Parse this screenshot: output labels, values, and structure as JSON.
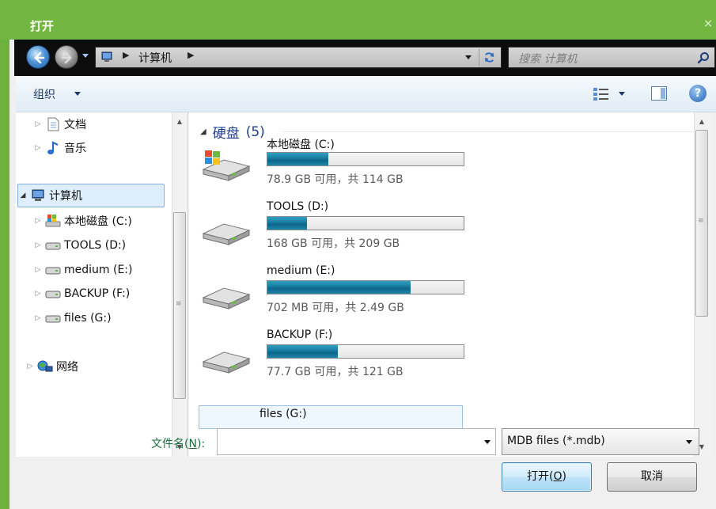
{
  "window": {
    "title": "打开",
    "close_glyph": "×"
  },
  "address": {
    "location": "计算机",
    "search_placeholder": "搜索 计算机"
  },
  "toolbar": {
    "organize": "组织"
  },
  "nav": {
    "items": [
      {
        "label": "文档",
        "icon": "document-icon"
      },
      {
        "label": "音乐",
        "icon": "music-icon"
      },
      {
        "label": "计算机",
        "icon": "computer-icon",
        "selected": true
      },
      {
        "label": "本地磁盘 (C:)",
        "icon": "windows-drive-icon"
      },
      {
        "label": "TOOLS (D:)",
        "icon": "drive-icon"
      },
      {
        "label": "medium (E:)",
        "icon": "drive-icon"
      },
      {
        "label": "BACKUP (F:)",
        "icon": "drive-icon"
      },
      {
        "label": "files (G:)",
        "icon": "drive-icon"
      },
      {
        "label": "网络",
        "icon": "network-icon"
      }
    ]
  },
  "content": {
    "group": {
      "title": "硬盘",
      "count": "(5)"
    },
    "drives": [
      {
        "name": "本地磁盘 (C:)",
        "space": "78.9 GB 可用，共 114 GB",
        "used_fraction": 0.31,
        "system": true
      },
      {
        "name": "TOOLS (D:)",
        "space": "168 GB 可用，共 209 GB",
        "used_fraction": 0.2,
        "system": false
      },
      {
        "name": "medium (E:)",
        "space": "702 MB 可用，共 2.49 GB",
        "used_fraction": 0.73,
        "system": false
      },
      {
        "name": "BACKUP (F:)",
        "space": "77.7 GB 可用，共 121 GB",
        "used_fraction": 0.36,
        "system": false
      },
      {
        "name": "files (G:)",
        "space": "",
        "used_fraction": 0,
        "system": false
      }
    ]
  },
  "bottom": {
    "filename_label_prefix": "文件名(",
    "filename_label_key": "N",
    "filename_label_suffix": "):",
    "filename_value": "",
    "filter_value": "MDB files (*.mdb)",
    "open_prefix": "打开(",
    "open_key": "O",
    "open_suffix": ")",
    "cancel": "取消"
  },
  "colors": {
    "titlebar": "#73b742",
    "progress_fill": "#1a7fa4",
    "group_header": "#1d3d8f"
  }
}
